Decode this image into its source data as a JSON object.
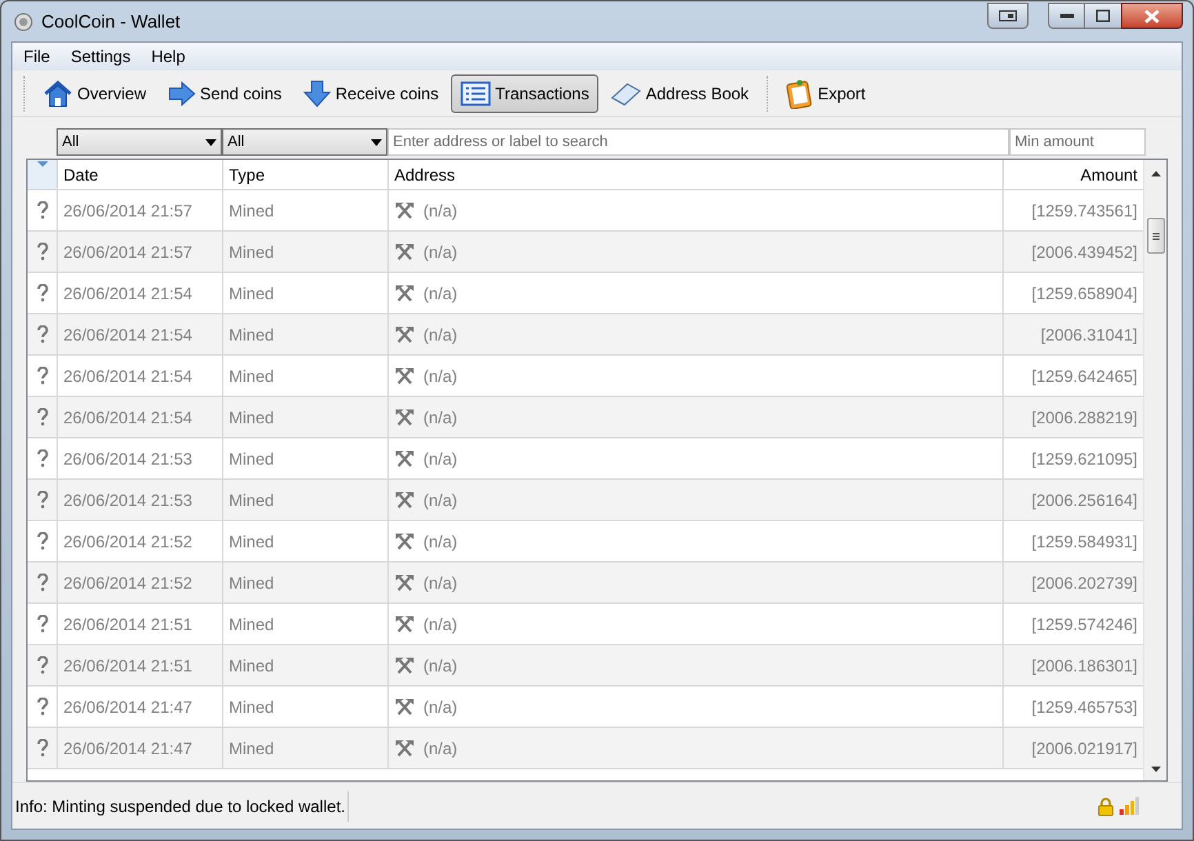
{
  "window": {
    "title": "CoolCoin - Wallet"
  },
  "menu": [
    "File",
    "Settings",
    "Help"
  ],
  "toolbar": [
    {
      "label": "Overview",
      "kind": "home",
      "selected": false
    },
    {
      "label": "Send coins",
      "kind": "send",
      "selected": false
    },
    {
      "label": "Receive coins",
      "kind": "receive",
      "selected": false
    },
    {
      "label": "Transactions",
      "kind": "list",
      "selected": true
    },
    {
      "label": "Address Book",
      "kind": "book",
      "selected": false
    },
    {
      "label": "Export",
      "kind": "export",
      "selected": false
    }
  ],
  "filters": {
    "date": "All",
    "type": "All",
    "search": {
      "placeholder": "Enter address or label to search"
    },
    "amount": {
      "placeholder": "Min amount"
    }
  },
  "table": {
    "columns": [
      "Date",
      "Type",
      "Address",
      "Amount"
    ],
    "rows": [
      {
        "date": "26/06/2014 21:57",
        "type": "Mined",
        "address": "(n/a)",
        "amount": "[1259.743561]"
      },
      {
        "date": "26/06/2014 21:57",
        "type": "Mined",
        "address": "(n/a)",
        "amount": "[2006.439452]"
      },
      {
        "date": "26/06/2014 21:54",
        "type": "Mined",
        "address": "(n/a)",
        "amount": "[1259.658904]"
      },
      {
        "date": "26/06/2014 21:54",
        "type": "Mined",
        "address": "(n/a)",
        "amount": "[2006.31041]"
      },
      {
        "date": "26/06/2014 21:54",
        "type": "Mined",
        "address": "(n/a)",
        "amount": "[1259.642465]"
      },
      {
        "date": "26/06/2014 21:54",
        "type": "Mined",
        "address": "(n/a)",
        "amount": "[2006.288219]"
      },
      {
        "date": "26/06/2014 21:53",
        "type": "Mined",
        "address": "(n/a)",
        "amount": "[1259.621095]"
      },
      {
        "date": "26/06/2014 21:53",
        "type": "Mined",
        "address": "(n/a)",
        "amount": "[2006.256164]"
      },
      {
        "date": "26/06/2014 21:52",
        "type": "Mined",
        "address": "(n/a)",
        "amount": "[1259.584931]"
      },
      {
        "date": "26/06/2014 21:52",
        "type": "Mined",
        "address": "(n/a)",
        "amount": "[2006.202739]"
      },
      {
        "date": "26/06/2014 21:51",
        "type": "Mined",
        "address": "(n/a)",
        "amount": "[1259.574246]"
      },
      {
        "date": "26/06/2014 21:51",
        "type": "Mined",
        "address": "(n/a)",
        "amount": "[2006.186301]"
      },
      {
        "date": "26/06/2014 21:47",
        "type": "Mined",
        "address": "(n/a)",
        "amount": "[1259.465753]"
      },
      {
        "date": "26/06/2014 21:47",
        "type": "Mined",
        "address": "(n/a)",
        "amount": "[2006.021917]"
      }
    ]
  },
  "status_bar": {
    "message": "Info: Minting suspended due to locked wallet."
  }
}
